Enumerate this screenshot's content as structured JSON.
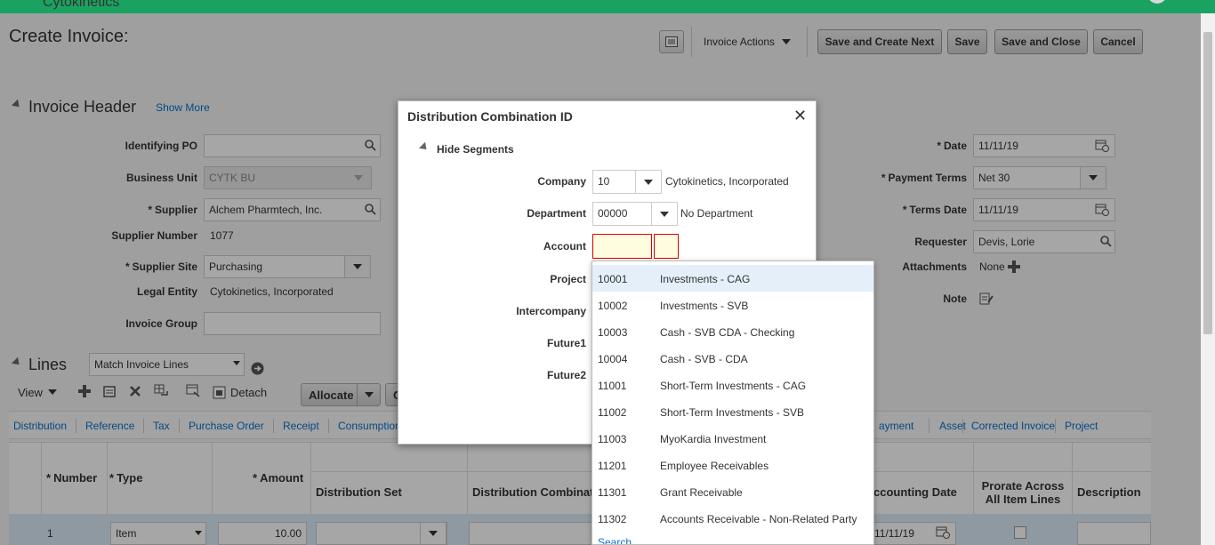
{
  "brand": "Cytokinetics",
  "page_title": "Create Invoice:",
  "toolbar": {
    "invoice_actions": "Invoice Actions",
    "save_and_create_next": "Save and Create Next",
    "save": "Save",
    "save_and_close": "Save and Close",
    "cancel": "Cancel"
  },
  "header": {
    "title": "Invoice Header",
    "show_more": "Show More",
    "identifying_po_label": "Identifying PO",
    "identifying_po_value": "",
    "business_unit_label": "Business Unit",
    "business_unit_value": "CYTK BU",
    "supplier_label": "Supplier",
    "supplier_value": "Alchem Pharmtech, Inc.",
    "supplier_number_label": "Supplier Number",
    "supplier_number_value": "1077",
    "supplier_site_label": "Supplier Site",
    "supplier_site_value": "Purchasing",
    "legal_entity_label": "Legal Entity",
    "legal_entity_value": "Cytokinetics, Incorporated",
    "invoice_group_label": "Invoice Group",
    "invoice_group_value": "",
    "date_label": "Date",
    "date_value": "11/11/19",
    "payment_terms_label": "Payment Terms",
    "payment_terms_value": "Net 30",
    "terms_date_label": "Terms Date",
    "terms_date_value": "11/11/19",
    "requester_label": "Requester",
    "requester_value": "Devis, Lorie",
    "attachments_label": "Attachments",
    "attachments_value": "None",
    "note_label": "Note"
  },
  "lines": {
    "title": "Lines",
    "match_select": "Match Invoice Lines",
    "view_label": "View",
    "detach_label": "Detach",
    "allocate_label": "Allocate",
    "partial_btn": "C",
    "tabs": [
      "Distribution",
      "Reference",
      "Tax",
      "Purchase Order",
      "Receipt",
      "Consumption",
      "ayment",
      "Asset",
      "Corrected Invoice",
      "Project"
    ],
    "columns": {
      "number": "Number",
      "type": "Type",
      "amount": "Amount",
      "distribution_set": "Distribution Set",
      "distribution_combination": "Distribution Combinati",
      "accounting_date": "ccounting Date",
      "prorate": "Prorate Across All Item Lines",
      "description": "Description"
    },
    "row": {
      "number": "1",
      "type": "Item",
      "amount": "10.00",
      "accounting_date": "11/11/19"
    }
  },
  "dialog": {
    "title": "Distribution Combination ID",
    "close": "✕",
    "hide_segments": "Hide Segments",
    "company_label": "Company",
    "company_value": "10",
    "company_desc": "Cytokinetics, Incorporated",
    "department_label": "Department",
    "department_value": "00000",
    "department_desc": "No Department",
    "account_label": "Account",
    "project_label": "Project",
    "intercompany_label": "Intercompany",
    "future1_label": "Future1",
    "future2_label": "Future2"
  },
  "account_lov": {
    "items": [
      {
        "code": "10001",
        "desc": "Investments - CAG"
      },
      {
        "code": "10002",
        "desc": "Investments - SVB"
      },
      {
        "code": "10003",
        "desc": "Cash - SVB CDA - Checking"
      },
      {
        "code": "10004",
        "desc": "Cash - SVB - CDA"
      },
      {
        "code": "11001",
        "desc": "Short-Term Investments - CAG"
      },
      {
        "code": "11002",
        "desc": "Short-Term Investments - SVB"
      },
      {
        "code": "11003",
        "desc": "MyoKardia Investment"
      },
      {
        "code": "11201",
        "desc": "Employee Receivables"
      },
      {
        "code": "11301",
        "desc": "Grant Receivable"
      },
      {
        "code": "11302",
        "desc": "Accounts Receivable - Non-Related Party"
      }
    ],
    "search": "Search"
  },
  "colors": {
    "brand_green": "#1aa260",
    "link_blue": "#0572ce",
    "error_red": "#dd0000"
  }
}
